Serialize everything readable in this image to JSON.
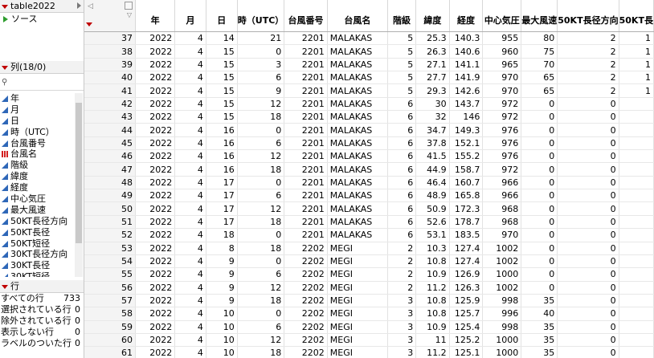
{
  "table_panel": {
    "title": "table2022",
    "source_label": "ソース"
  },
  "columns_panel": {
    "title": "列(18/0)",
    "items": [
      {
        "label": "年",
        "type": "continuous"
      },
      {
        "label": "月",
        "type": "continuous"
      },
      {
        "label": "日",
        "type": "continuous"
      },
      {
        "label": "時（UTC）",
        "type": "continuous"
      },
      {
        "label": "台風番号",
        "type": "continuous"
      },
      {
        "label": "台風名",
        "type": "nominal"
      },
      {
        "label": "階級",
        "type": "continuous"
      },
      {
        "label": "緯度",
        "type": "continuous"
      },
      {
        "label": "経度",
        "type": "continuous"
      },
      {
        "label": "中心気圧",
        "type": "continuous"
      },
      {
        "label": "最大風速",
        "type": "continuous"
      },
      {
        "label": "50KT長径方向",
        "type": "continuous"
      },
      {
        "label": "50KT長径",
        "type": "continuous"
      },
      {
        "label": "50KT短径",
        "type": "continuous"
      },
      {
        "label": "30KT長径方向",
        "type": "continuous"
      },
      {
        "label": "30KT長径",
        "type": "continuous"
      },
      {
        "label": "30KT短径",
        "type": "continuous"
      }
    ]
  },
  "rows_panel": {
    "title": "行",
    "stats": [
      {
        "label": "すべての行",
        "value": "733"
      },
      {
        "label": "選択されている行",
        "value": "0"
      },
      {
        "label": "除外されている行",
        "value": "0"
      },
      {
        "label": "表示しない行",
        "value": "0"
      },
      {
        "label": "ラベルのついた行",
        "value": "0"
      }
    ]
  },
  "grid": {
    "headers": [
      "年",
      "月",
      "日",
      "時（UTC）",
      "台風番号",
      "台風名",
      "階級",
      "緯度",
      "経度",
      "中心気圧",
      "最大風速",
      "50KT長径方向",
      "50KT長"
    ],
    "rows": [
      [
        "37",
        "2022",
        "4",
        "14",
        "21",
        "2201",
        "MALAKAS",
        "5",
        "25.3",
        "140.3",
        "955",
        "80",
        "2",
        "1"
      ],
      [
        "38",
        "2022",
        "4",
        "15",
        "0",
        "2201",
        "MALAKAS",
        "5",
        "26.3",
        "140.6",
        "960",
        "75",
        "2",
        "1"
      ],
      [
        "39",
        "2022",
        "4",
        "15",
        "3",
        "2201",
        "MALAKAS",
        "5",
        "27.1",
        "141.1",
        "965",
        "70",
        "2",
        "1"
      ],
      [
        "40",
        "2022",
        "4",
        "15",
        "6",
        "2201",
        "MALAKAS",
        "5",
        "27.7",
        "141.9",
        "970",
        "65",
        "2",
        "1"
      ],
      [
        "41",
        "2022",
        "4",
        "15",
        "9",
        "2201",
        "MALAKAS",
        "5",
        "29.3",
        "142.6",
        "970",
        "65",
        "2",
        "1"
      ],
      [
        "42",
        "2022",
        "4",
        "15",
        "12",
        "2201",
        "MALAKAS",
        "6",
        "30",
        "143.7",
        "972",
        "0",
        "0",
        ""
      ],
      [
        "43",
        "2022",
        "4",
        "15",
        "18",
        "2201",
        "MALAKAS",
        "6",
        "32",
        "146",
        "972",
        "0",
        "0",
        ""
      ],
      [
        "44",
        "2022",
        "4",
        "16",
        "0",
        "2201",
        "MALAKAS",
        "6",
        "34.7",
        "149.3",
        "976",
        "0",
        "0",
        ""
      ],
      [
        "45",
        "2022",
        "4",
        "16",
        "6",
        "2201",
        "MALAKAS",
        "6",
        "37.8",
        "152.1",
        "976",
        "0",
        "0",
        ""
      ],
      [
        "46",
        "2022",
        "4",
        "16",
        "12",
        "2201",
        "MALAKAS",
        "6",
        "41.5",
        "155.2",
        "976",
        "0",
        "0",
        ""
      ],
      [
        "47",
        "2022",
        "4",
        "16",
        "18",
        "2201",
        "MALAKAS",
        "6",
        "44.9",
        "158.7",
        "972",
        "0",
        "0",
        ""
      ],
      [
        "48",
        "2022",
        "4",
        "17",
        "0",
        "2201",
        "MALAKAS",
        "6",
        "46.4",
        "160.7",
        "966",
        "0",
        "0",
        ""
      ],
      [
        "49",
        "2022",
        "4",
        "17",
        "6",
        "2201",
        "MALAKAS",
        "6",
        "48.9",
        "165.8",
        "966",
        "0",
        "0",
        ""
      ],
      [
        "50",
        "2022",
        "4",
        "17",
        "12",
        "2201",
        "MALAKAS",
        "6",
        "50.9",
        "172.3",
        "968",
        "0",
        "0",
        ""
      ],
      [
        "51",
        "2022",
        "4",
        "17",
        "18",
        "2201",
        "MALAKAS",
        "6",
        "52.6",
        "178.7",
        "968",
        "0",
        "0",
        ""
      ],
      [
        "52",
        "2022",
        "4",
        "18",
        "0",
        "2201",
        "MALAKAS",
        "6",
        "53.1",
        "183.5",
        "970",
        "0",
        "0",
        ""
      ],
      [
        "53",
        "2022",
        "4",
        "8",
        "18",
        "2202",
        "MEGI",
        "2",
        "10.3",
        "127.4",
        "1002",
        "0",
        "0",
        ""
      ],
      [
        "54",
        "2022",
        "4",
        "9",
        "0",
        "2202",
        "MEGI",
        "2",
        "10.8",
        "127.4",
        "1002",
        "0",
        "0",
        ""
      ],
      [
        "55",
        "2022",
        "4",
        "9",
        "6",
        "2202",
        "MEGI",
        "2",
        "10.9",
        "126.9",
        "1000",
        "0",
        "0",
        ""
      ],
      [
        "56",
        "2022",
        "4",
        "9",
        "12",
        "2202",
        "MEGI",
        "2",
        "11.2",
        "126.3",
        "1002",
        "0",
        "0",
        ""
      ],
      [
        "57",
        "2022",
        "4",
        "9",
        "18",
        "2202",
        "MEGI",
        "3",
        "10.8",
        "125.9",
        "998",
        "35",
        "0",
        ""
      ],
      [
        "58",
        "2022",
        "4",
        "10",
        "0",
        "2202",
        "MEGI",
        "3",
        "10.8",
        "125.7",
        "996",
        "40",
        "0",
        ""
      ],
      [
        "59",
        "2022",
        "4",
        "10",
        "6",
        "2202",
        "MEGI",
        "3",
        "10.9",
        "125.4",
        "998",
        "35",
        "0",
        ""
      ],
      [
        "60",
        "2022",
        "4",
        "10",
        "12",
        "2202",
        "MEGI",
        "3",
        "11",
        "125.2",
        "1000",
        "35",
        "0",
        ""
      ],
      [
        "61",
        "2022",
        "4",
        "10",
        "18",
        "2202",
        "MEGI",
        "3",
        "11.2",
        "125.1",
        "1000",
        "35",
        "0",
        ""
      ]
    ]
  }
}
